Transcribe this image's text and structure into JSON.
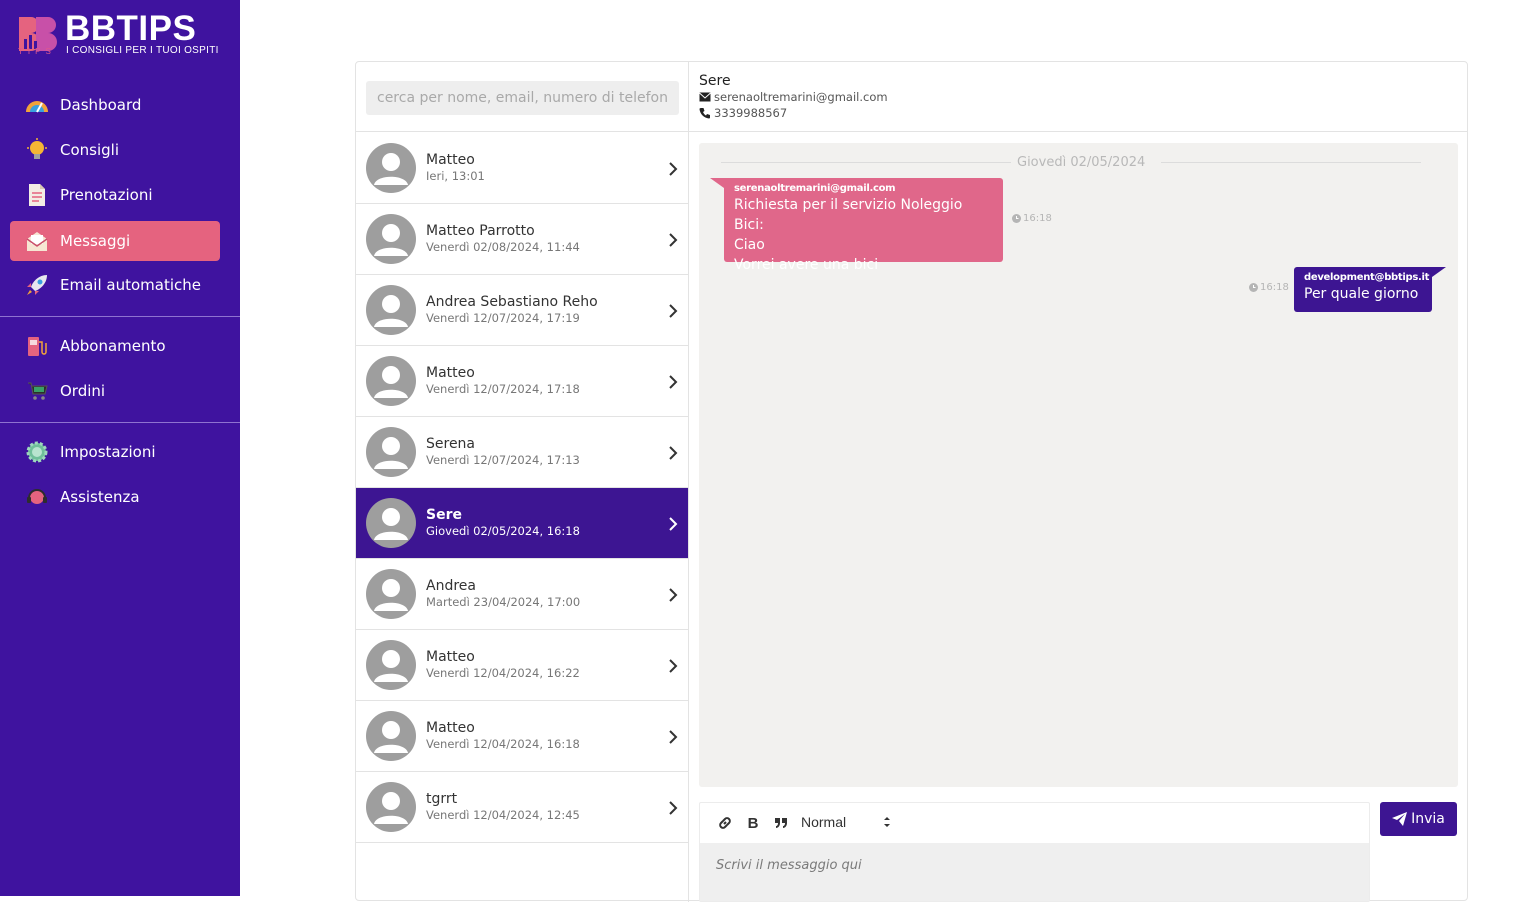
{
  "brand": {
    "title": "BBTIPS",
    "tips": "TIPS",
    "tagline": "I CONSIGLI PER I TUOI OSPITI",
    "accent": "#e5637f",
    "sidebar_bg": "#3f139f"
  },
  "sidebar": {
    "items": [
      {
        "label": "Dashboard",
        "icon": "speedometer-icon"
      },
      {
        "label": "Consigli",
        "icon": "lightbulb-icon"
      },
      {
        "label": "Prenotazioni",
        "icon": "document-icon"
      },
      {
        "label": "Messaggi",
        "icon": "envelope-icon",
        "active": true
      },
      {
        "label": "Email automatiche",
        "icon": "rocket-icon"
      },
      {
        "label": "Abbonamento",
        "icon": "gas-pump-icon"
      },
      {
        "label": "Ordini",
        "icon": "cart-icon"
      },
      {
        "label": "Impostazioni",
        "icon": "gear-icon"
      },
      {
        "label": "Assistenza",
        "icon": "headset-icon"
      }
    ]
  },
  "search": {
    "placeholder": "cerca per nome, email, numero di telefono"
  },
  "contacts": [
    {
      "name": "Matteo",
      "date": "Ieri, 13:01"
    },
    {
      "name": "Matteo Parrotto",
      "date": "Venerdì 02/08/2024, 11:44"
    },
    {
      "name": "Andrea Sebastiano Reho",
      "date": "Venerdì 12/07/2024, 17:19"
    },
    {
      "name": "Matteo",
      "date": "Venerdì 12/07/2024, 17:18"
    },
    {
      "name": "Serena",
      "date": "Venerdì 12/07/2024, 17:13"
    },
    {
      "name": "Sere",
      "date": "Giovedì 02/05/2024, 16:18",
      "active": true
    },
    {
      "name": "Andrea",
      "date": "Martedì 23/04/2024, 17:00"
    },
    {
      "name": "Matteo",
      "date": "Venerdì 12/04/2024, 16:22"
    },
    {
      "name": "Matteo",
      "date": "Venerdì 12/04/2024, 16:18"
    },
    {
      "name": "tgrrt",
      "date": "Venerdì 12/04/2024, 12:45"
    }
  ],
  "chat": {
    "name": "Sere",
    "email": "serenaoltremarini@gmail.com",
    "phone": "3339988567",
    "day": "Giovedì 02/05/2024",
    "incoming": {
      "sender": "serenaoltremarini@gmail.com",
      "text": "Richiesta per il servizio Noleggio Bici:\nCiao\nVorrei avere una bici",
      "time": "16:18"
    },
    "outgoing": {
      "sender": "development@bbtips.it",
      "text": "Per quale giorno",
      "time": "16:18"
    }
  },
  "composer": {
    "format": "Normal",
    "placeholder": "Scrivi il messaggio qui",
    "send_label": "Invia"
  }
}
